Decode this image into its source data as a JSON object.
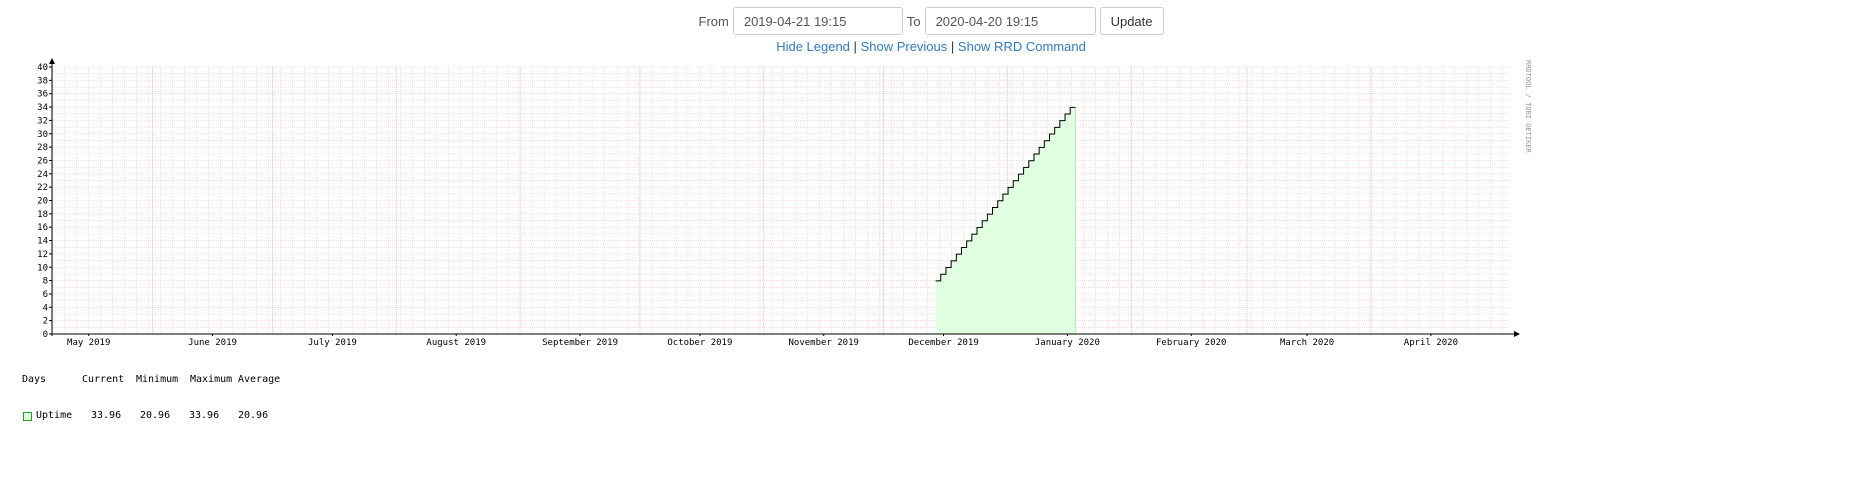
{
  "controls": {
    "from_label": "From",
    "from_value": "2019-04-21 19:15",
    "to_label": "To",
    "to_value": "2020-04-20 19:15",
    "update_label": "Update"
  },
  "links": {
    "hide_legend": "Hide Legend",
    "separator": "|",
    "show_previous": "Show Previous",
    "show_rrd": "Show RRD Command"
  },
  "watermark": "RRDTOOL / TOBI OETIKER",
  "colors": {
    "area_fill": "#e0ffe0",
    "line": "#000000",
    "major_grid": "#ff9c9c",
    "minor_grid": "#f0c8c8",
    "legend_border": "#2a9d2a"
  },
  "chart_data": {
    "type": "area",
    "x_axis": {
      "start": "2019-04-21 19:15",
      "end": "2020-04-20 19:15",
      "tick_labels": [
        "May 2019",
        "June 2019",
        "July 2019",
        "August 2019",
        "September 2019",
        "October 2019",
        "November 2019",
        "December 2019",
        "January 2020",
        "February 2020",
        "March 2020",
        "April 2020"
      ]
    },
    "y_axis": {
      "ylim": [
        0,
        40
      ],
      "tick_labels": [
        "0",
        "2",
        "4",
        "6",
        "8",
        "10",
        "12",
        "14",
        "16",
        "18",
        "20",
        "22",
        "24",
        "26",
        "28",
        "30",
        "32",
        "34",
        "36",
        "38",
        "40"
      ]
    },
    "grid": true,
    "series": [
      {
        "name": "Uptime",
        "points": [
          {
            "x": "2019-11-29",
            "y": 7.96
          },
          {
            "x": "2020-01-03",
            "y": 33.96
          }
        ]
      }
    ],
    "legend": {
      "header": [
        "Days",
        "Current",
        "Minimum",
        "Maximum",
        "Average"
      ],
      "rows": [
        {
          "name": "Uptime",
          "current": "33.96",
          "minimum": "20.96",
          "maximum": "33.96",
          "average": "20.96"
        }
      ]
    }
  }
}
